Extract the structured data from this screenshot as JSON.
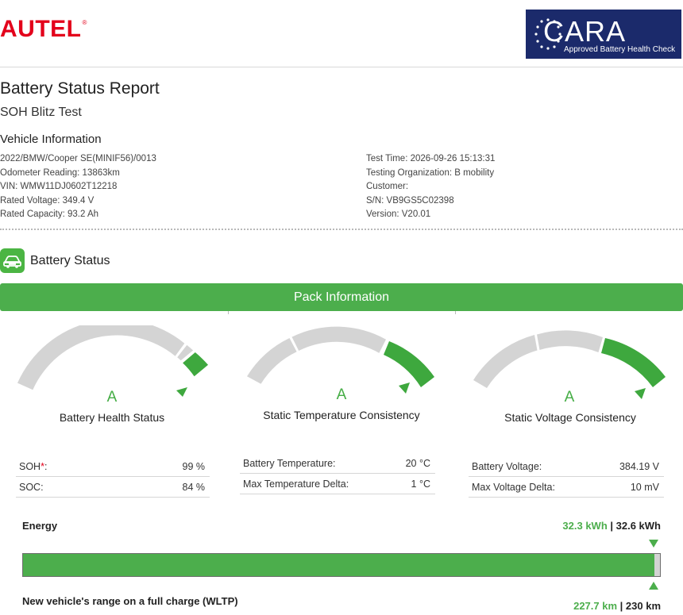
{
  "header": {
    "brand": "AUTEL",
    "brand_mark": "®",
    "badge_title": "CARA",
    "badge_subtitle": "Approved Battery Health Check",
    "brand_color": "#e3001b",
    "badge_color": "#1b2a6b"
  },
  "report": {
    "title": "Battery Status Report",
    "subtitle": "SOH Blitz Test"
  },
  "vehicle_info": {
    "title": "Vehicle Information",
    "left": [
      "2022/BMW/Cooper SE(MINIF56)/0013",
      "Odometer Reading: 13863km",
      "VIN: WMW11DJ0602T12218",
      "Rated Voltage: 349.4 V",
      "Rated Capacity: 93.2 Ah"
    ],
    "right": [
      "Test Time: 2026-09-26 15:13:31",
      "Testing Organization: B mobility",
      "Customer:",
      "S/N: VB9GS5C02398",
      "Version: V20.01"
    ]
  },
  "battery_status": {
    "title": "Battery Status",
    "icon": "car-battery-icon",
    "pack_header": "Pack Information",
    "accent_color": "#4cae4c"
  },
  "gauges": [
    {
      "grade": "A",
      "label": "Battery Health Status",
      "level": 0.99,
      "rows": [
        {
          "key": "SOH",
          "mark": "*",
          "suffix": ":",
          "value": "99 %"
        },
        {
          "key": "SOC:",
          "mark": "",
          "suffix": "",
          "value": "84 %"
        }
      ]
    },
    {
      "grade": "A",
      "label": "Static Temperature Consistency",
      "level": 0.9,
      "rows": [
        {
          "key": "Battery Temperature:",
          "mark": "",
          "suffix": "",
          "value": "20 °C"
        },
        {
          "key": "Max Temperature Delta:",
          "mark": "",
          "suffix": "",
          "value": "1 °C"
        }
      ]
    },
    {
      "grade": "A",
      "label": "Static Voltage Consistency",
      "level": 0.9,
      "rows": [
        {
          "key": "Battery Voltage:",
          "mark": "",
          "suffix": "",
          "value": "384.19 V"
        },
        {
          "key": "Max Voltage Delta:",
          "mark": "",
          "suffix": "",
          "value": "10 mV"
        }
      ]
    }
  ],
  "energy": {
    "label": "Energy",
    "current": "32.3 kWh",
    "separator": " | ",
    "nominal": "32.6 kWh",
    "fill_fraction": 0.9908
  },
  "range": {
    "label": "New vehicle's range on a full charge (WLTP)",
    "current": "227.7 km",
    "separator": " | ",
    "nominal": "230 km"
  }
}
